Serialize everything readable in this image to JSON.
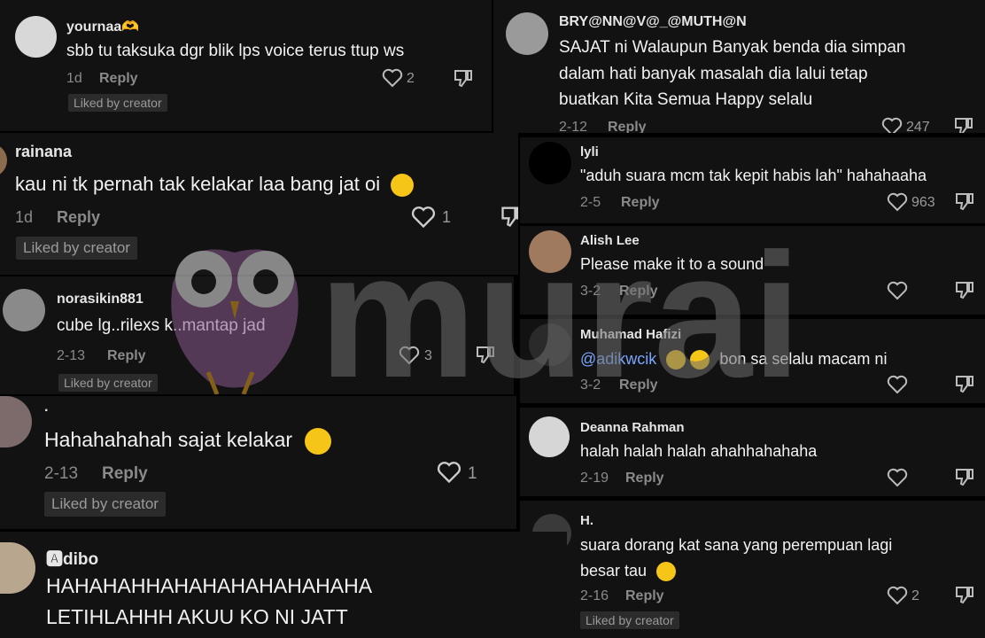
{
  "comments": [
    {
      "username": "yournaa🫶",
      "text": "sbb tu taksuka dgr blik lps voice terus ttup ws",
      "date": "1d",
      "reply": "Reply",
      "likes": "2",
      "badge": "Liked by creator"
    },
    {
      "username": "BRY@NN@V@_@MUTH@N",
      "text_lines": [
        "SAJAT ni Walaupun Banyak benda dia simpan",
        "dalam hati banyak masalah dia lalui tetap",
        "buatkan Kita Semua Happy selalu"
      ],
      "date": "2-12",
      "reply": "Reply",
      "likes": "247"
    },
    {
      "username": "rainana",
      "text": "kau ni tk pernah tak kelakar laa bang jat oi",
      "date": "1d",
      "reply": "Reply",
      "likes": "1",
      "badge": "Liked by creator"
    },
    {
      "username": "lyli",
      "text": "\"aduh suara mcm tak kepit habis lah\" hahahaaha",
      "date": "2-5",
      "reply": "Reply",
      "likes": "963"
    },
    {
      "username": "Alish Lee",
      "text": "Please make it to a sound",
      "date": "3-2",
      "reply": "Reply"
    },
    {
      "username": "norasikin881",
      "text": "cube lg..rilexs k..mantap jad",
      "date": "2-13",
      "reply": "Reply",
      "likes": "3",
      "badge": "Liked by creator"
    },
    {
      "username": "Muhamad Hafizi",
      "mention": "@adikwcik",
      "text": "bon sa selalu macam ni",
      "date": "3-2",
      "reply": "Reply"
    },
    {
      "username": ".",
      "text": "Hahahahahah sajat kelakar",
      "date": "2-13",
      "reply": "Reply",
      "likes": "1",
      "badge": "Liked by creator"
    },
    {
      "username": "Deanna Rahman",
      "text": "halah halah halah ahahhahahaha",
      "date": "2-19",
      "reply": "Reply"
    },
    {
      "username": "H.",
      "text_lines": [
        "suara dorang kat sana yang perempuan lagi",
        "besar tau"
      ],
      "date": "2-16",
      "reply": "Reply",
      "likes": "2",
      "badge": "Liked by creator"
    },
    {
      "username": "🅰dibo",
      "text_lines": [
        "HAHAHAHHAHAHAHAHAHAHAHA",
        "LETIHLAHHH AKUU KO NI JATT"
      ]
    }
  ],
  "watermark": "murai",
  "icons": [
    "heart-icon",
    "dislike-icon",
    "emoji-icon"
  ],
  "colors": {
    "background": "#121212",
    "mention": "#7aa6ff",
    "watermark": "#6e6e6e",
    "owl": "#8a5a8f"
  }
}
